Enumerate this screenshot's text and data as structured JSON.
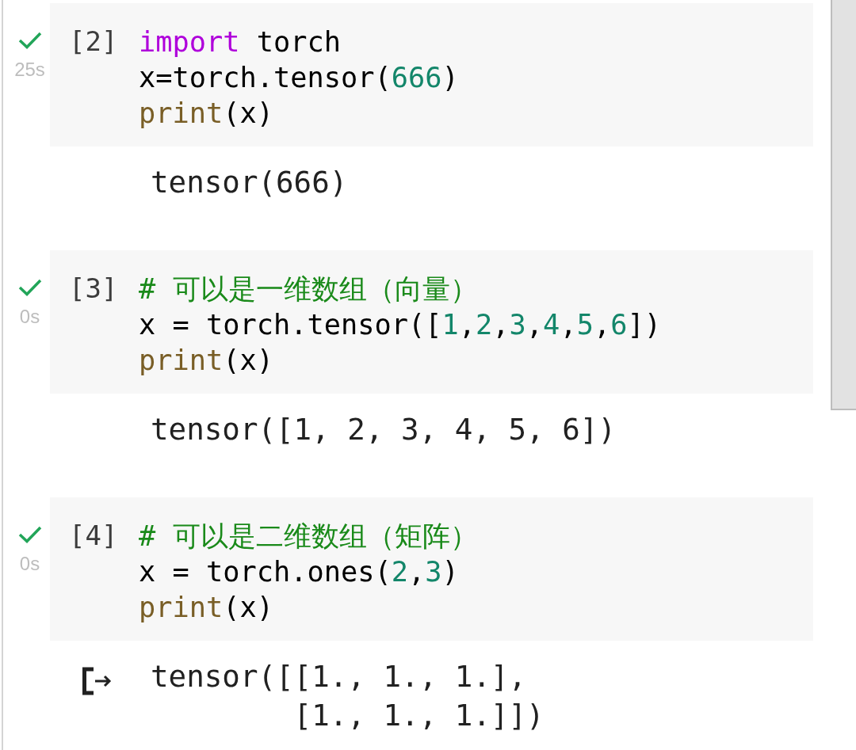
{
  "cells": [
    {
      "execution_count": "[2]",
      "succeeded": true,
      "duration": "25s",
      "code": [
        [
          {
            "kind": "keyword",
            "text": "import"
          },
          {
            "kind": "plain",
            "text": " torch"
          }
        ],
        [
          {
            "kind": "plain",
            "text": "x=torch.tensor("
          },
          {
            "kind": "number",
            "text": "666"
          },
          {
            "kind": "plain",
            "text": ")"
          }
        ],
        [
          {
            "kind": "function",
            "text": "print"
          },
          {
            "kind": "plain",
            "text": "(x)"
          }
        ]
      ],
      "output": "tensor(666)",
      "output_icon": false
    },
    {
      "execution_count": "[3]",
      "succeeded": true,
      "duration": "0s",
      "code": [
        [
          {
            "kind": "comment",
            "text": "# 可以是一维数组（向量）"
          }
        ],
        [
          {
            "kind": "plain",
            "text": "x = torch.tensor(["
          },
          {
            "kind": "number",
            "text": "1"
          },
          {
            "kind": "plain",
            "text": ","
          },
          {
            "kind": "number",
            "text": "2"
          },
          {
            "kind": "plain",
            "text": ","
          },
          {
            "kind": "number",
            "text": "3"
          },
          {
            "kind": "plain",
            "text": ","
          },
          {
            "kind": "number",
            "text": "4"
          },
          {
            "kind": "plain",
            "text": ","
          },
          {
            "kind": "number",
            "text": "5"
          },
          {
            "kind": "plain",
            "text": ","
          },
          {
            "kind": "number",
            "text": "6"
          },
          {
            "kind": "plain",
            "text": "])"
          }
        ],
        [
          {
            "kind": "function",
            "text": "print"
          },
          {
            "kind": "plain",
            "text": "(x)"
          }
        ]
      ],
      "output": "tensor([1, 2, 3, 4, 5, 6])",
      "output_icon": false
    },
    {
      "execution_count": "[4]",
      "succeeded": true,
      "duration": "0s",
      "code": [
        [
          {
            "kind": "comment",
            "text": "# 可以是二维数组（矩阵）"
          }
        ],
        [
          {
            "kind": "plain",
            "text": "x = torch.ones("
          },
          {
            "kind": "number",
            "text": "2"
          },
          {
            "kind": "plain",
            "text": ","
          },
          {
            "kind": "number",
            "text": "3"
          },
          {
            "kind": "plain",
            "text": ")"
          }
        ],
        [
          {
            "kind": "function",
            "text": "print"
          },
          {
            "kind": "plain",
            "text": "(x)"
          }
        ]
      ],
      "output": "tensor([[1., 1., 1.],\n        [1., 1., 1.]])",
      "output_icon": true
    }
  ]
}
